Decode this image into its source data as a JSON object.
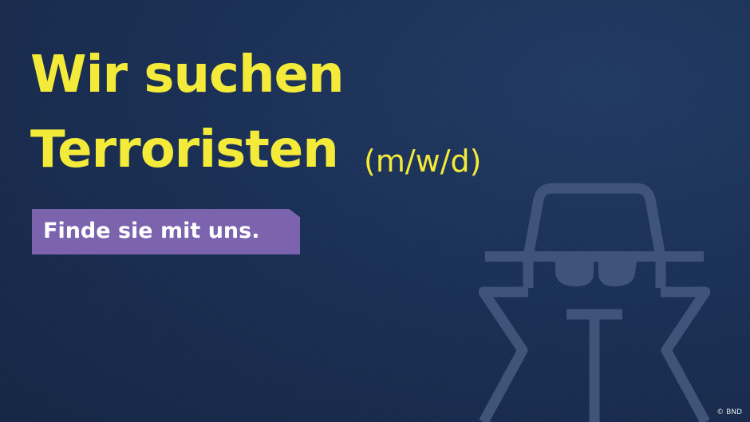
{
  "poster": {
    "headline_line1": "Wir suchen",
    "headline_line2": "Terroristen",
    "gender_tag": "(m/w/d)",
    "tagline": "Finde sie mit uns.",
    "copyright": "© BND",
    "spy_icon": "spy-silhouette-icon"
  },
  "colors": {
    "background": "#182a4d",
    "headline": "#f4ea3a",
    "tagline_background": "#7b63ad",
    "tagline_text": "#ffffff",
    "icon_stroke": "#3f5478"
  }
}
